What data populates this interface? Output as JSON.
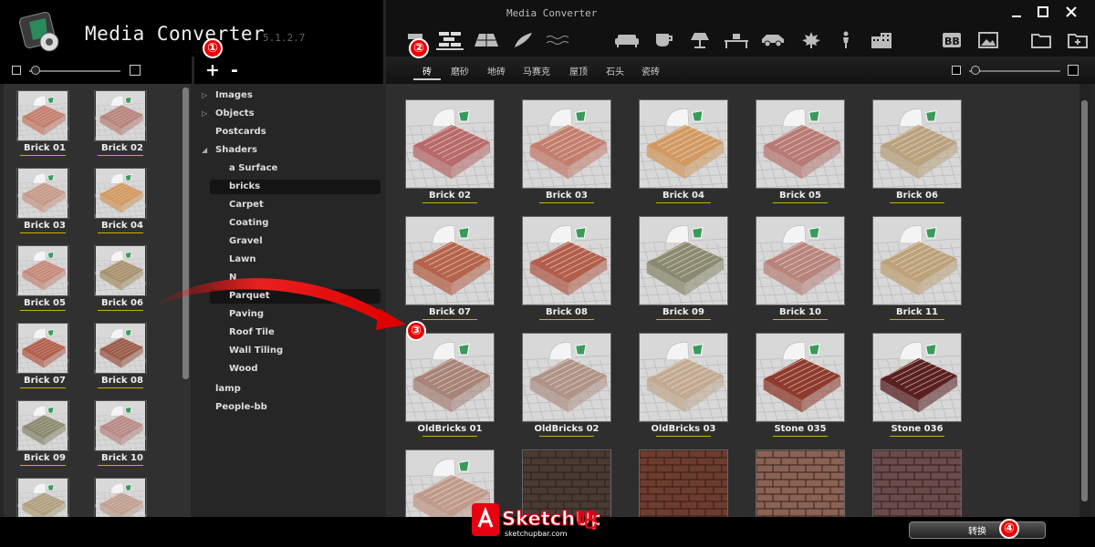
{
  "app": {
    "title": "Media Converter",
    "version": "5.1.2.7",
    "window_title": "Media Converter"
  },
  "window_controls": [
    "minimize",
    "maximize",
    "close"
  ],
  "toolbar": {
    "add_label": "+",
    "remove_label": "-",
    "category_icons": [
      "paint-roller-icon",
      "brick-wall-icon",
      "paving-icon",
      "leaf-brush-icon",
      "water-icon",
      "sofa-icon",
      "cup-icon",
      "lamp-icon",
      "desk-icon",
      "car-icon",
      "maple-leaf-icon",
      "person-icon",
      "building-icon"
    ],
    "right_icons": [
      "bb-icon",
      "image-icon",
      "folder-icon",
      "new-folder-icon"
    ]
  },
  "left_thumbs": [
    "Brick 01",
    "Brick 02",
    "Brick 03",
    "Brick 04",
    "Brick 05",
    "Brick 06",
    "Brick 07",
    "Brick 08",
    "Brick 09",
    "Brick 10",
    "",
    ""
  ],
  "tree": {
    "items": [
      {
        "label": "Images",
        "level": 0,
        "expander": "collapsed"
      },
      {
        "label": "Objects",
        "level": 0,
        "expander": "collapsed"
      },
      {
        "label": "Postcards",
        "level": 0,
        "expander": ""
      },
      {
        "label": "Shaders",
        "level": 0,
        "expander": "expanded"
      },
      {
        "label": "a Surface",
        "level": 1,
        "expander": ""
      },
      {
        "label": "bricks",
        "level": 1,
        "expander": "",
        "selected": true
      },
      {
        "label": "Carpet",
        "level": 1,
        "expander": ""
      },
      {
        "label": "Coating",
        "level": 1,
        "expander": ""
      },
      {
        "label": "Gravel",
        "level": 1,
        "expander": ""
      },
      {
        "label": "Lawn",
        "level": 1,
        "expander": ""
      },
      {
        "label": "N",
        "level": 1,
        "expander": ""
      },
      {
        "label": "Parquet",
        "level": 1,
        "expander": "",
        "hover": true
      },
      {
        "label": "Paving",
        "level": 1,
        "expander": ""
      },
      {
        "label": "Roof Tile",
        "level": 1,
        "expander": ""
      },
      {
        "label": "Wall Tiling",
        "level": 1,
        "expander": ""
      },
      {
        "label": "Wood",
        "level": 1,
        "expander": ""
      },
      {
        "label": "lamp",
        "level": 0,
        "expander": ""
      },
      {
        "label": "People-bb",
        "level": 0,
        "expander": ""
      }
    ]
  },
  "category_tabs": [
    "砖",
    "磨砂",
    "地砖",
    "马赛克",
    "屋顶",
    "石头",
    "瓷砖"
  ],
  "active_tab": "砖",
  "grid": [
    {
      "label": "Brick 02",
      "color": "#b86a6a"
    },
    {
      "label": "Brick 03",
      "color": "#c47e6e"
    },
    {
      "label": "Brick 04",
      "color": "#d29a62"
    },
    {
      "label": "Brick 05",
      "color": "#b87a74"
    },
    {
      "label": "Brick 06",
      "color": "#b9a27e"
    },
    {
      "label": "Brick 07",
      "color": "#b5634a"
    },
    {
      "label": "Brick 08",
      "color": "#b25e4a"
    },
    {
      "label": "Brick 09",
      "color": "#8a8a70"
    },
    {
      "label": "Brick 10",
      "color": "#b8847c"
    },
    {
      "label": "Brick 11",
      "color": "#bda27a"
    },
    {
      "label": "OldBricks 01",
      "color": "#a88478"
    },
    {
      "label": "OldBricks 02",
      "color": "#b09488"
    },
    {
      "label": "OldBricks 03",
      "color": "#c2ab92"
    },
    {
      "label": "Stone 035",
      "color": "#8e3a2c"
    },
    {
      "label": "Stone 036",
      "color": "#5a2020"
    },
    {
      "label": "",
      "color": "#c09a8a"
    },
    {
      "label": "",
      "color": "#4a3a34"
    },
    {
      "label": "",
      "color": "#6e3c2e"
    },
    {
      "label": "",
      "color": "#8a6254"
    },
    {
      "label": "",
      "color": "#6a4a4a"
    }
  ],
  "convert_button": "转换",
  "badges": [
    "①",
    "②",
    "③",
    "④"
  ],
  "watermark": {
    "brand": "SketchUp吧",
    "url": "sketchupbar.com"
  }
}
